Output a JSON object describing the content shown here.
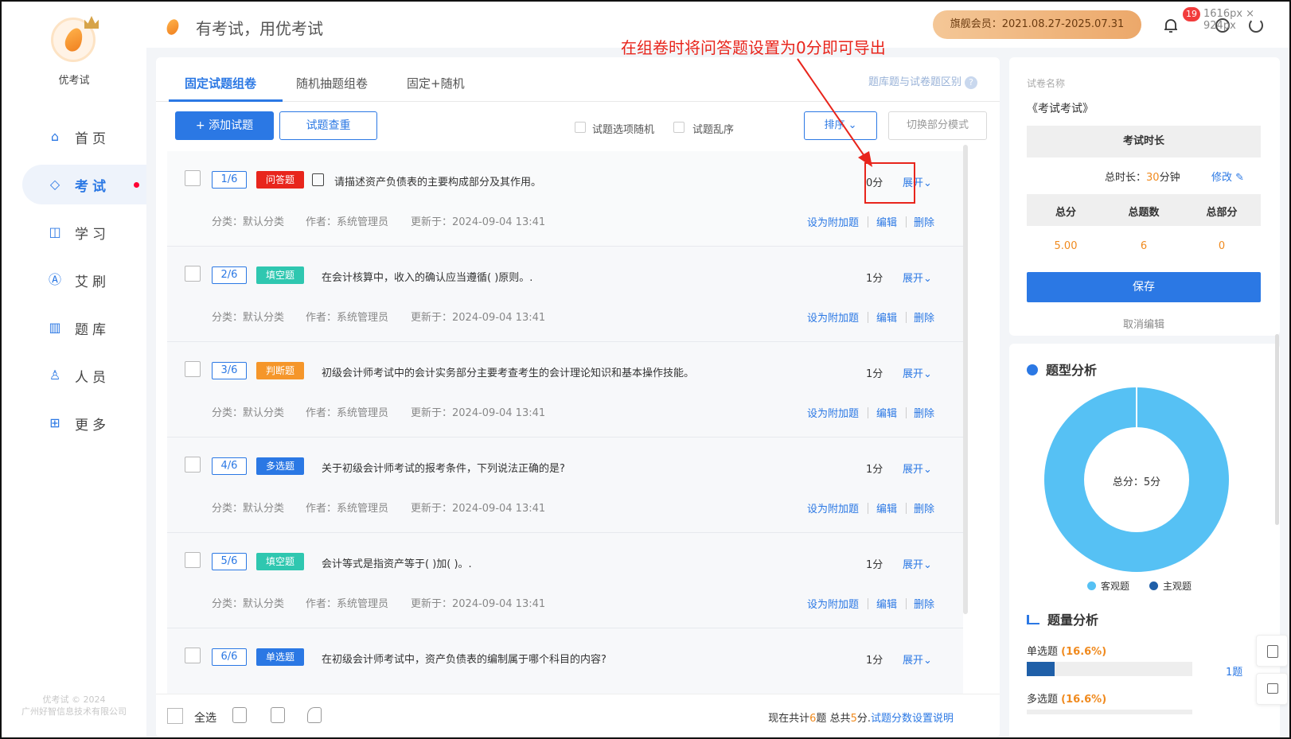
{
  "sidebar": {
    "logo_name": "优考试",
    "items": [
      {
        "label": "首页",
        "icon": "home-icon",
        "glyph": "⌂"
      },
      {
        "label": "考试",
        "icon": "exam-icon",
        "glyph": "◇"
      },
      {
        "label": "学习",
        "icon": "book-icon",
        "glyph": "◫"
      },
      {
        "label": "艾刷",
        "icon": "a-icon",
        "glyph": "Ⓐ"
      },
      {
        "label": "题库",
        "icon": "bank-icon",
        "glyph": "▥"
      },
      {
        "label": "人员",
        "icon": "user-icon",
        "glyph": "♙"
      },
      {
        "label": "更多",
        "icon": "more-icon",
        "glyph": "⊞"
      }
    ],
    "footer_line1": "优考试 © 2024",
    "footer_line2": "广州好智信息技术有限公司"
  },
  "header": {
    "slogan": "有考试，用优考试",
    "vip": "旗舰会员：2021.08.27-2025.07.31",
    "badge": "19",
    "dims": "1616px × 924px"
  },
  "tabs": {
    "fixed": "固定试题组卷",
    "random": "随机抽题组卷",
    "mixed": "固定+随机",
    "diff_link": "题库题与试卷题区别",
    "diff_q": "?"
  },
  "toolbar": {
    "add": "+ 添加试题",
    "dup": "试题查重",
    "opt_random": "试题选项随机",
    "order_random": "试题乱序",
    "sort": "排序 ⌄",
    "mode": "切换部分模式"
  },
  "questions": [
    {
      "num": "1/6",
      "type": "问答题",
      "color": "#e8251c",
      "text": "请描述资产负债表的主要构成部分及其作用。",
      "score": "0分"
    },
    {
      "num": "2/6",
      "type": "填空题",
      "color": "#2fc7b0",
      "text": "在会计核算中，收入的确认应当遵循(   )原则。.",
      "score": "1分"
    },
    {
      "num": "3/6",
      "type": "判断题",
      "color": "#f5962a",
      "text": "初级会计师考试中的会计实务部分主要考查考生的会计理论知识和基本操作技能。",
      "score": "1分"
    },
    {
      "num": "4/6",
      "type": "多选题",
      "color": "#2b78e4",
      "text": "关于初级会计师考试的报考条件，下列说法正确的是?",
      "score": "1分"
    },
    {
      "num": "5/6",
      "type": "填空题",
      "color": "#2fc7b0",
      "text": "会计等式是指资产等于(   )加(   )。.",
      "score": "1分"
    },
    {
      "num": "6/6",
      "type": "单选题",
      "color": "#2b78e4",
      "text": "在初级会计师考试中，资产负债表的编制属于哪个科目的内容?",
      "score": "1分"
    }
  ],
  "question_common": {
    "expand": "展开⌄",
    "category": "分类：默认分类",
    "author": "作者：系统管理员",
    "updated": "更新于：2024-09-04 13:41",
    "set_extra": "设为附加题",
    "edit": "编辑",
    "delete": "删除"
  },
  "footer": {
    "select_all": "全选",
    "summary_pre": "现在共计",
    "count": "6",
    "summary_mid": "题 总共",
    "total": "5",
    "summary_post": "分.",
    "link": "试题分数设置说明"
  },
  "paper": {
    "name_label": "试卷名称",
    "name": "《考试考试》",
    "duration_head": "考试时长",
    "duration_pre": "总时长：",
    "duration_val": "30",
    "duration_post": "分钟",
    "edit": "修改 ✎",
    "stat_heads": [
      "总分",
      "总题数",
      "总部分"
    ],
    "stat_vals": [
      "5.00",
      "6",
      "0"
    ],
    "save": "保存",
    "cancel": "取消编辑"
  },
  "analysis": {
    "type_title": "题型分析",
    "donut_label": "总分：5分",
    "legend_objective": "客观题",
    "legend_subjective": "主观题",
    "objective_color": "#56c1f4",
    "subjective_color": "#1f5fa8",
    "count_title": "题量分析",
    "rows": [
      {
        "label": "单选题",
        "pct": "(16.6%)",
        "fraction": 0.166,
        "num": "1题"
      },
      {
        "label": "多选题",
        "pct": "(16.6%)",
        "fraction": 0.166,
        "num": ""
      }
    ]
  },
  "annotation": "在组卷时将问答题设置为0分即可导出"
}
